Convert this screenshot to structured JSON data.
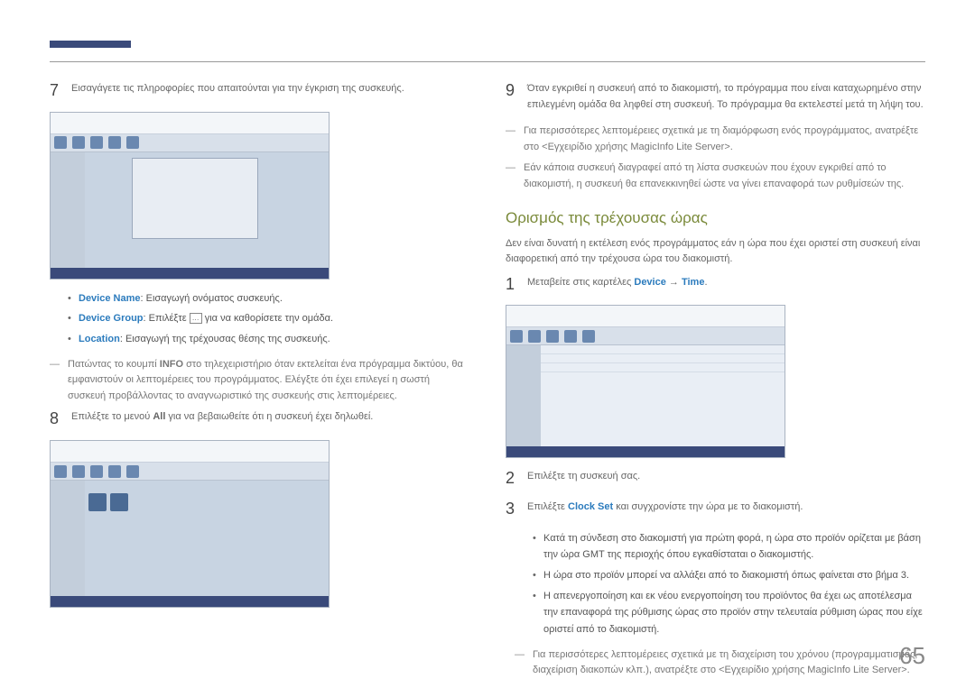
{
  "left": {
    "step7": "Εισαγάγετε τις πληροφορίες που απαιτούνται για την έγκριση της συσκευής.",
    "bullets": {
      "b1_label": "Device Name",
      "b1_text": ": Εισαγωγή ονόματος συσκευής.",
      "b2_label": "Device Group",
      "b2_text_a": ": Επιλέξτε ",
      "b2_text_b": " για να καθορίσετε την ομάδα.",
      "b3_label": "Location",
      "b3_text": ": Εισαγωγή της τρέχουσας θέσης της συσκευής."
    },
    "note1_a": "Πατώντας το κουμπί ",
    "note1_info": "INFO",
    "note1_b": " στο τηλεχειριστήριο όταν εκτελείται ένα πρόγραμμα δικτύου, θα εμφανιστούν οι λεπτομέρειες του προγράμματος. Ελέγξτε ότι έχει επιλεγεί η σωστή συσκευή προβάλλοντας το αναγνωριστικό της συσκευής στις λεπτομέρειες.",
    "step8_a": "Επιλέξτε το μενού ",
    "step8_all": "All",
    "step8_b": " για να βεβαιωθείτε ότι η συσκευή έχει δηλωθεί."
  },
  "right": {
    "step9": "Όταν εγκριθεί η συσκευή από το διακομιστή, το πρόγραμμα που είναι καταχωρημένο στην επιλεγμένη ομάδα θα ληφθεί στη συσκευή. Το πρόγραμμα θα εκτελεστεί μετά τη λήψη του.",
    "note_a": "Για περισσότερες λεπτομέρειες σχετικά με τη διαμόρφωση ενός προγράμματος, ανατρέξτε στο <Εγχειρίδιο χρήσης MagicInfo Lite Server>.",
    "note_b": "Εάν κάποια συσκευή διαγραφεί από τη λίστα συσκευών που έχουν εγκριθεί από το διακομιστή, η συσκευή θα επανεκκινηθεί ώστε να γίνει επαναφορά των ρυθμίσεών της.",
    "section_title": "Ορισμός της τρέχουσας ώρας",
    "intro": "Δεν είναι δυνατή η εκτέλεση ενός προγράμματος εάν η ώρα που έχει οριστεί στη συσκευή είναι διαφορετική από την τρέχουσα ώρα του διακομιστή.",
    "step1_a": "Μεταβείτε στις καρτέλες ",
    "step1_device": "Device",
    "step1_arrow": " → ",
    "step1_time": "Time",
    "step1_b": ".",
    "step2": "Επιλέξτε τη συσκευή σας.",
    "step3_a": "Επιλέξτε ",
    "step3_clock": "Clock Set",
    "step3_b": " και συγχρονίστε την ώρα με το διακομιστή.",
    "sb1": "Κατά τη σύνδεση στο διακομιστή για πρώτη φορά, η ώρα στο προϊόν ορίζεται με βάση την ώρα GMT της περιοχής όπου εγκαθίσταται ο διακομιστής.",
    "sb2": "Η ώρα στο προϊόν μπορεί να αλλάξει από το διακομιστή όπως φαίνεται στο βήμα 3.",
    "sb3": "Η απενεργοποίηση και εκ νέου ενεργοποίηση του προϊόντος θα έχει ως αποτέλεσμα την επαναφορά της ρύθμισης ώρας στο προϊόν στην τελευταία ρύθμιση ώρας που είχε οριστεί από το διακομιστή.",
    "note_c": "Για περισσότερες λεπτομέρειες σχετικά με τη διαχείριση του χρόνου (προγραμματισμός, διαχείριση διακοπών κλπ.), ανατρέξτε στο <Εγχειρίδιο χρήσης MagicInfo Lite Server>."
  },
  "page_number": "65"
}
